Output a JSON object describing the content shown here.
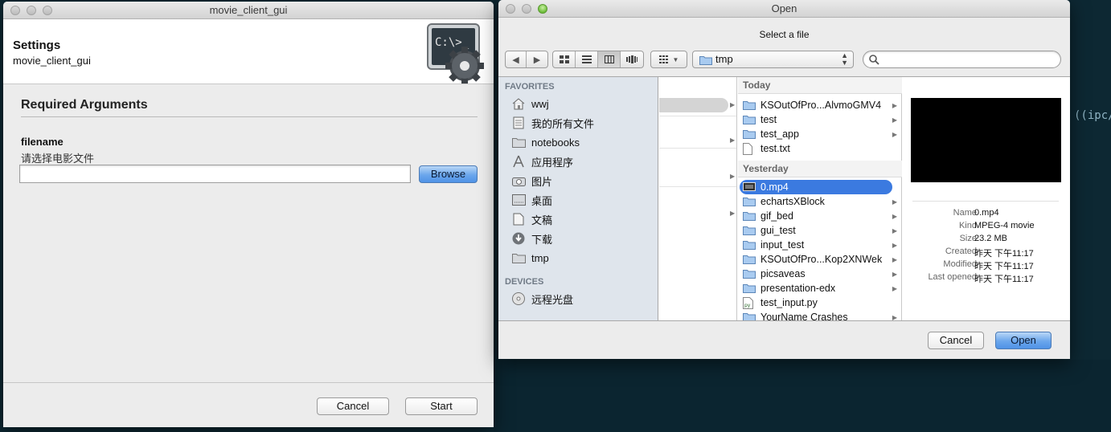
{
  "terminal": {
    "visible_text": "((ipc/"
  },
  "settings_window": {
    "title": "movie_client_gui",
    "header_title": "Settings",
    "header_subtitle": "movie_client_gui",
    "header_icon": "terminal-gear-icon",
    "section_title": "Required Arguments",
    "field": {
      "label": "filename",
      "help": "请选择电影文件",
      "value": "",
      "browse_label": "Browse"
    },
    "cancel_label": "Cancel",
    "start_label": "Start"
  },
  "open_dialog": {
    "title": "Open",
    "message": "Select a file",
    "path": "tmp",
    "search_placeholder": "",
    "sidebar": {
      "favorites_header": "FAVORITES",
      "favorites": [
        {
          "label": "wwj",
          "icon": "home-icon"
        },
        {
          "label": "我的所有文件",
          "icon": "all-files-icon"
        },
        {
          "label": "notebooks",
          "icon": "folder-icon"
        },
        {
          "label": "应用程序",
          "icon": "applications-icon"
        },
        {
          "label": "图片",
          "icon": "camera-icon"
        },
        {
          "label": "桌面",
          "icon": "desktop-icon"
        },
        {
          "label": "文稿",
          "icon": "document-icon"
        },
        {
          "label": "下载",
          "icon": "download-icon"
        },
        {
          "label": "tmp",
          "icon": "folder-icon"
        }
      ],
      "devices_header": "DEVICES",
      "devices": [
        {
          "label": "远程光盘",
          "icon": "disc-icon"
        }
      ]
    },
    "groups": [
      {
        "header": "Today",
        "items": [
          {
            "name": "KSOutOfPro...AlvmoGMV4",
            "type": "folder",
            "has_children": true
          },
          {
            "name": "test",
            "type": "folder",
            "has_children": true
          },
          {
            "name": "test_app",
            "type": "folder",
            "has_children": true
          },
          {
            "name": "test.txt",
            "type": "file",
            "has_children": false
          }
        ]
      },
      {
        "header": "Yesterday",
        "items": [
          {
            "name": "0.mp4",
            "type": "movie",
            "has_children": false,
            "selected": true
          },
          {
            "name": "echartsXBlock",
            "type": "folder",
            "has_children": true
          },
          {
            "name": "gif_bed",
            "type": "folder",
            "has_children": true
          },
          {
            "name": "gui_test",
            "type": "folder",
            "has_children": true
          },
          {
            "name": "input_test",
            "type": "folder",
            "has_children": true
          },
          {
            "name": "KSOutOfPro...Kop2XNWek",
            "type": "folder",
            "has_children": true
          },
          {
            "name": "picsaveas",
            "type": "folder",
            "has_children": true
          },
          {
            "name": "presentation-edx",
            "type": "folder",
            "has_children": true
          },
          {
            "name": "test_input.py",
            "type": "python",
            "has_children": false
          },
          {
            "name": "YourName Crashes",
            "type": "folder",
            "has_children": true
          }
        ]
      }
    ],
    "preview": {
      "meta": [
        {
          "key": "Name",
          "value": "0.mp4"
        },
        {
          "key": "Kind",
          "value": "MPEG-4 movie"
        },
        {
          "key": "Size",
          "value": "23.2 MB"
        },
        {
          "key": "Created",
          "value": "昨天 下午11:17"
        },
        {
          "key": "Modified",
          "value": "昨天 下午11:17"
        },
        {
          "key": "Last opened",
          "value": "昨天 下午11:17"
        }
      ]
    },
    "cancel_label": "Cancel",
    "open_label": "Open"
  }
}
